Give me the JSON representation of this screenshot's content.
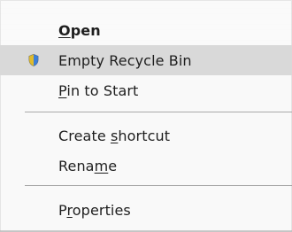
{
  "menu": {
    "items": [
      {
        "label": "Open",
        "underline_letter_index": 0,
        "bold": true,
        "hovered": false
      },
      {
        "label": "Empty Recycle Bin",
        "underline_letter_index": null,
        "bold": false,
        "hovered": true,
        "icon": "shield-icon"
      },
      {
        "label": "Pin to Start",
        "underline_letter_index": 0,
        "bold": false,
        "hovered": false
      },
      {
        "label": "Create shortcut",
        "underline_letter_index": 7,
        "bold": false,
        "hovered": false
      },
      {
        "label": "Rename",
        "underline_letter_index": 4,
        "bold": false,
        "hovered": false
      },
      {
        "label": "Properties",
        "underline_letter_index": 1,
        "bold": false,
        "hovered": false
      }
    ]
  },
  "colors": {
    "menu_bg": "#fafafa",
    "hover_bg": "#d9d9d9",
    "separator": "#8d8d8d",
    "text": "#1e1e1e"
  }
}
